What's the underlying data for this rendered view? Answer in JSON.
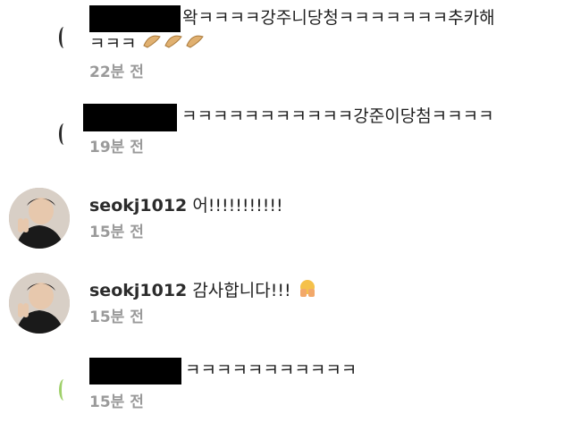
{
  "comments": [
    {
      "text_line1": "왁ㅋㅋㅋㅋ강주니당청ㅋㅋㅋㅋㅋㅋㅋ추카해",
      "text_line2": "ㅋㅋㅋ",
      "emoji": "croissant-emoji ×3",
      "time": "22분 전"
    },
    {
      "text": "ㅋㅋㅋㅋㅋㅋㅋㅋㅋㅋㅋ강준이당첨ㅋㅋㅋㅋ",
      "time": "19분 전"
    },
    {
      "username": "seokj1012",
      "text": " 어!!!!!!!!!!!",
      "time": "15분 전"
    },
    {
      "username": "seokj1012",
      "text": " 감사합니다!!!",
      "emoji": "pleading-hands-emoji",
      "time": "15분 전"
    },
    {
      "text": "ㅋㅋㅋㅋㅋㅋㅋㅋㅋㅋㅋ",
      "time": "15분 전"
    }
  ]
}
